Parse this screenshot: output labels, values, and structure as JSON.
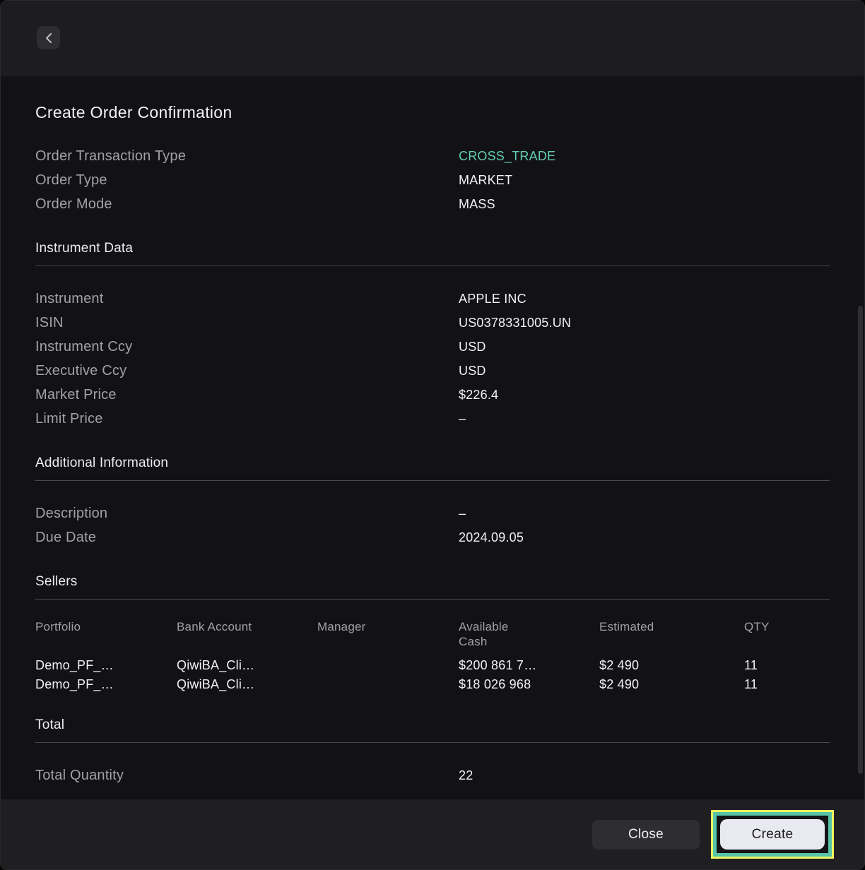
{
  "topbar": {
    "back_icon": "chevron-left"
  },
  "page": {
    "title": "Create Order Confirmation"
  },
  "order": {
    "rows": [
      {
        "label": "Order Transaction Type",
        "value": "CROSS_TRADE"
      },
      {
        "label": "Order Type",
        "value": "MARKET"
      },
      {
        "label": "Order Mode",
        "value": "MASS"
      }
    ]
  },
  "instrument_section": {
    "title": "Instrument Data",
    "rows": [
      {
        "label": "Instrument",
        "value": "APPLE INC"
      },
      {
        "label": "ISIN",
        "value": "US0378331005.UN"
      },
      {
        "label": "Instrument Ccy",
        "value": "USD"
      },
      {
        "label": "Executive Ccy",
        "value": "USD"
      },
      {
        "label": "Market Price",
        "value": "$226.4"
      },
      {
        "label": "Limit Price",
        "value": "–"
      }
    ]
  },
  "additional_section": {
    "title": "Additional Information",
    "rows": [
      {
        "label": "Description",
        "value": "–"
      },
      {
        "label": "Due Date",
        "value": "2024.09.05"
      }
    ]
  },
  "sellers_section": {
    "title": "Sellers",
    "columns": [
      "Portfolio",
      "Bank Account",
      "Manager",
      "Available Cash",
      "Estimated",
      "QTY"
    ],
    "rows": [
      [
        "Demo_PF_…",
        "QiwiBA_Cli…",
        "",
        "$200 861 7…",
        "$2 490",
        "11"
      ],
      [
        "Demo_PF_…",
        "QiwiBA_Cli…",
        "",
        "$18 026 968",
        "$2 490",
        "11"
      ]
    ]
  },
  "total_section": {
    "title": "Total",
    "rows": [
      {
        "label": "Total Quantity",
        "value": "22"
      }
    ]
  },
  "footer": {
    "close_label": "Close",
    "create_label": "Create"
  },
  "colors": {
    "accent_teal": "#63cbb6",
    "highlight_border_teal": "#57c3a8",
    "highlight_border_yellow": "#f0f562",
    "topbar_bg": "#1d1d20",
    "content_bg": "#121214",
    "footer_bg": "#1f1f22",
    "button_dark_bg": "#2e2e31",
    "button_light_bg": "#e9e9f2"
  }
}
